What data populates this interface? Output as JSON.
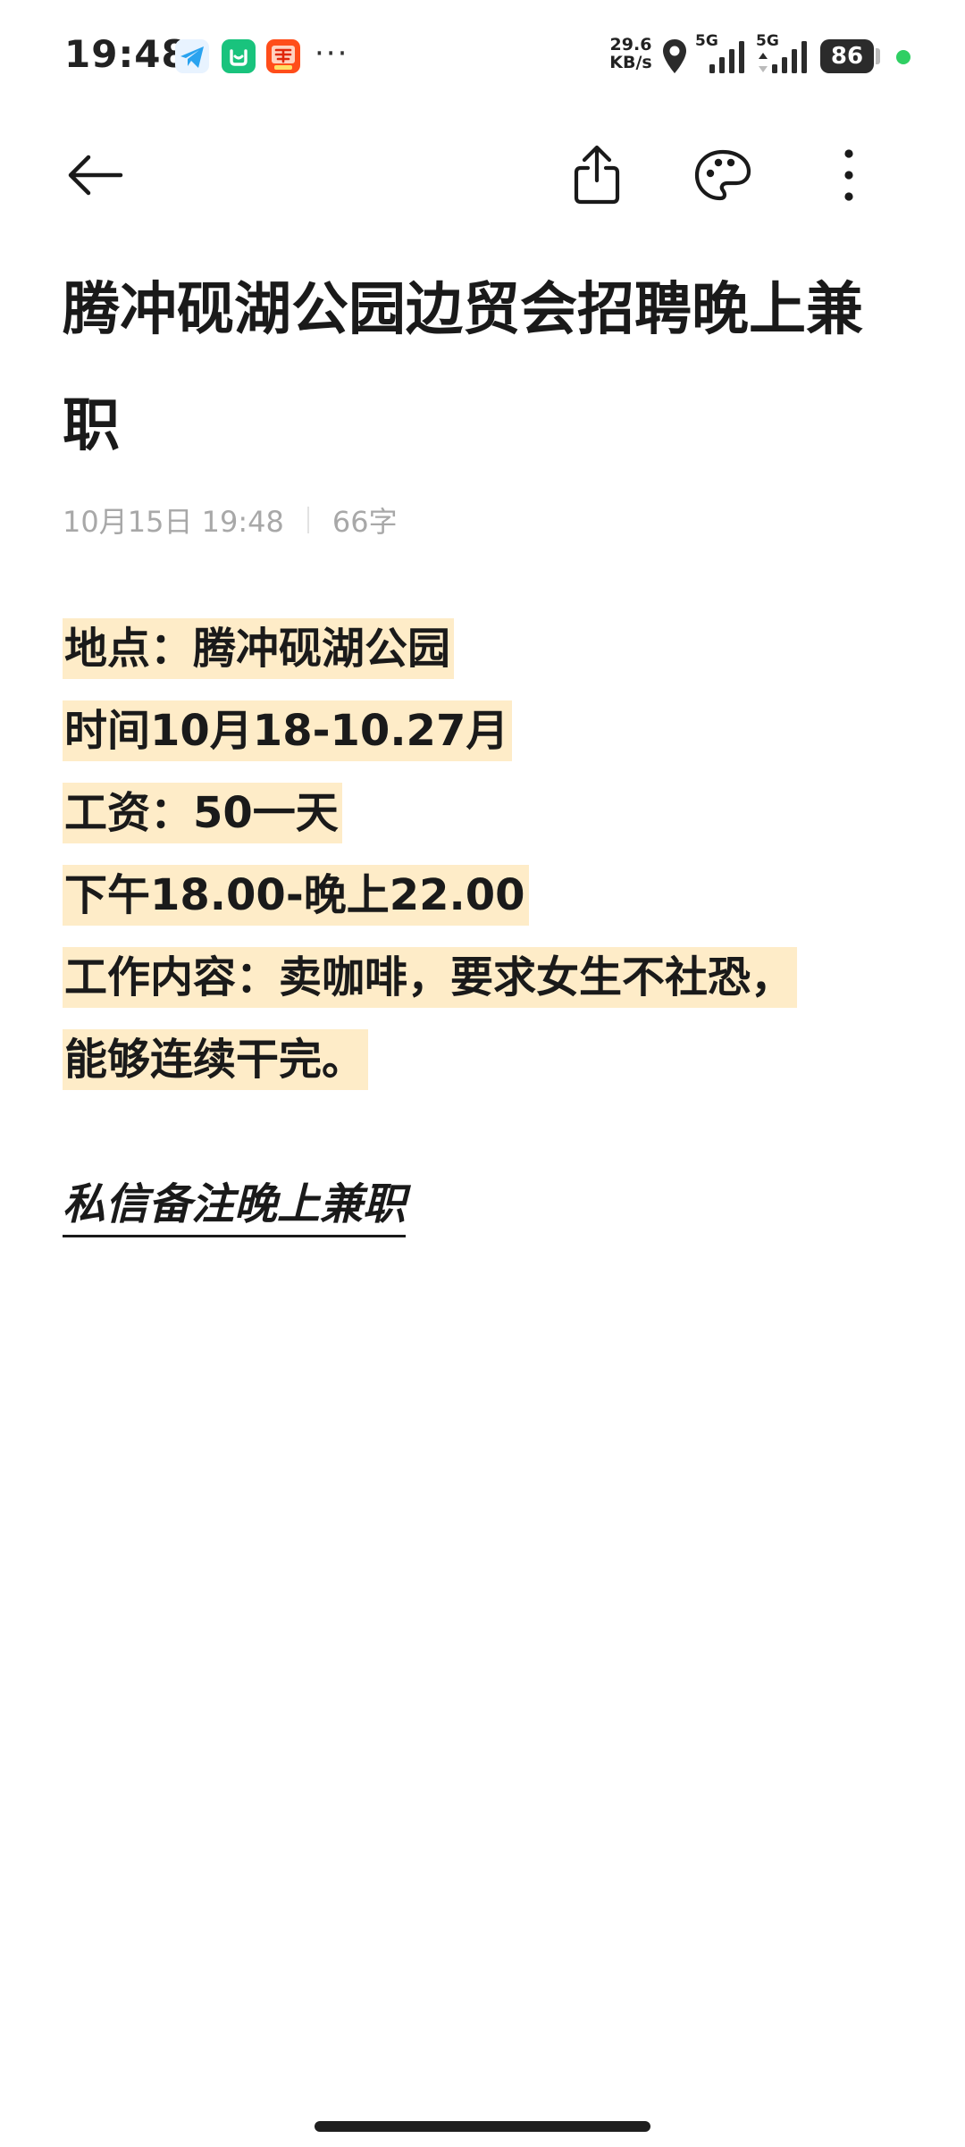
{
  "status_bar": {
    "time": "19:48",
    "apps": [
      "telegram-icon",
      "wechat-mini-icon",
      "taobao-icon"
    ],
    "more": "···",
    "net_speed_value": "29.6",
    "net_speed_unit": "KB/s",
    "sim1_label": "5G",
    "sim2_label": "5G",
    "battery": "86"
  },
  "toolbar": {
    "back_icon": "arrow-left-icon",
    "share_icon": "share-icon",
    "theme_icon": "palette-icon",
    "more_icon": "more-vertical-icon"
  },
  "note": {
    "title": "腾冲砚湖公园边贸会招聘晚上兼职",
    "date": "10月15日 19:48",
    "word_count": "66字",
    "lines": [
      "地点：腾冲砚湖公园",
      "时间10月18-10.27月",
      "工资：50一天",
      "下午18.00-晚上22.00",
      "工作内容：卖咖啡，要求女生不社恐，",
      "能够连续干完。"
    ],
    "footer": "私信备注晚上兼职"
  },
  "colors": {
    "highlight": "#feecc8",
    "text": "#1a1a1a",
    "meta": "#a8a8a8",
    "status_dot": "#2fcf63"
  }
}
